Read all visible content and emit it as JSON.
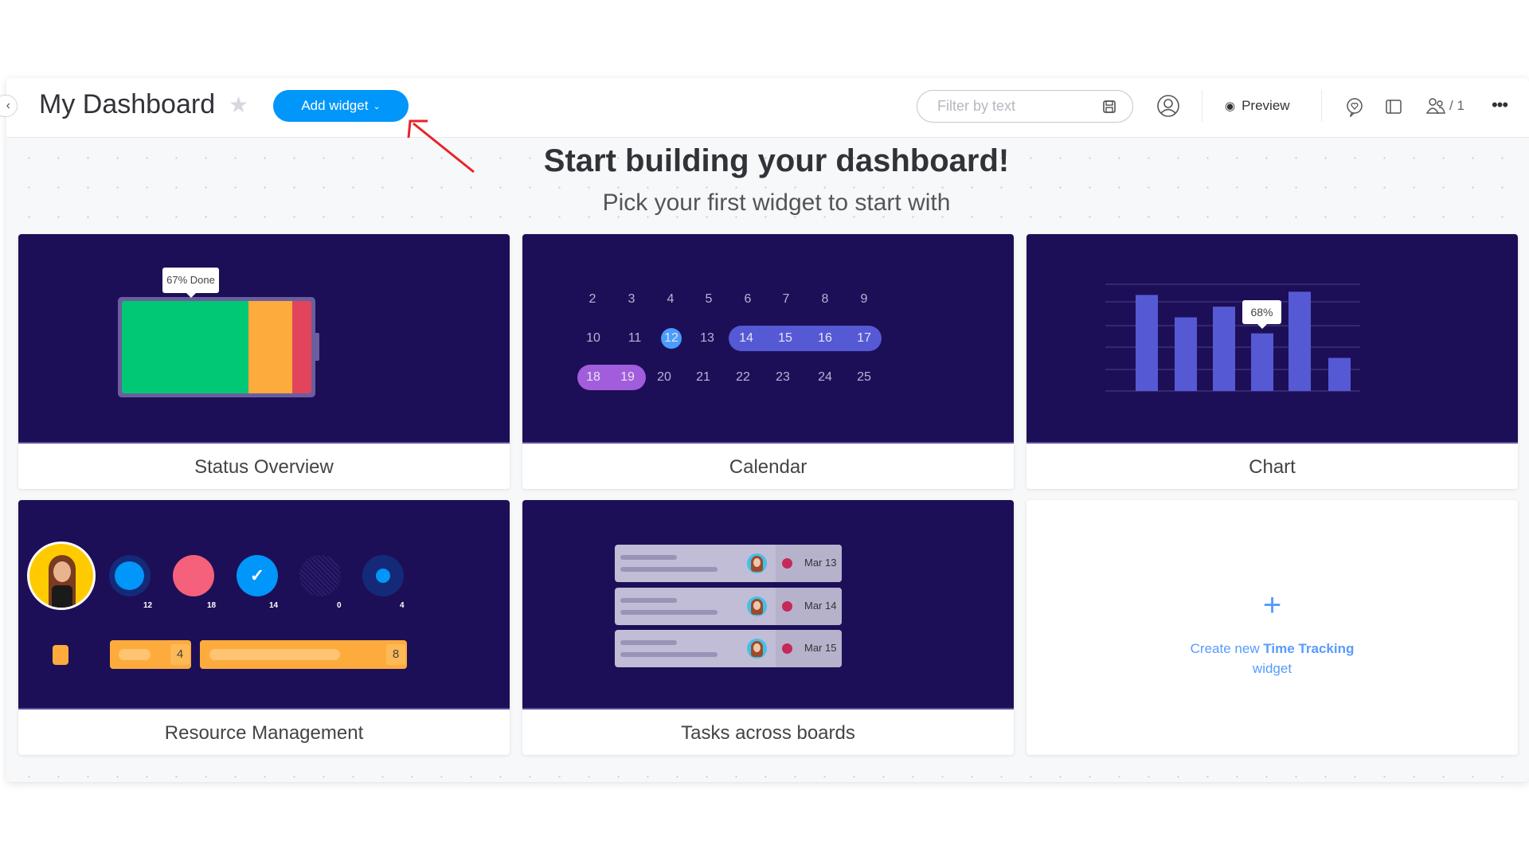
{
  "header": {
    "title": "My Dashboard",
    "add_widget_label": "Add widget",
    "filter_placeholder": "Filter by text",
    "preview_label": "Preview",
    "members_count": "/ 1"
  },
  "intro": {
    "heading": "Start building your dashboard!",
    "subheading": "Pick your first widget to start with"
  },
  "widgets": [
    {
      "label": "Status Overview",
      "tooltip": "67% Done",
      "done_percent": 67,
      "colors": {
        "done": "#00c875",
        "working": "#fdab3d",
        "stuck": "#e2445c"
      }
    },
    {
      "label": "Calendar",
      "rows": [
        [
          "2",
          "3",
          "4",
          "5",
          "6",
          "7",
          "8",
          "9"
        ],
        [
          "10",
          "11",
          "12",
          "13",
          "14",
          "15",
          "16",
          "17"
        ],
        [
          "18",
          "19",
          "20",
          "21",
          "22",
          "23",
          "24",
          "25"
        ]
      ],
      "today": "12"
    },
    {
      "label": "Chart",
      "tooltip": "68%"
    },
    {
      "label": "Resource Management",
      "counts": [
        "12",
        "18",
        "14",
        "0",
        "4"
      ],
      "bar_values": [
        "4",
        "8"
      ]
    },
    {
      "label": "Tasks across boards",
      "dates": [
        "Mar 13",
        "Mar 14",
        "Mar 15"
      ]
    }
  ],
  "create_widget": {
    "prefix": "Create new",
    "name": "Time Tracking",
    "suffix": "widget"
  },
  "chart_data": {
    "type": "bar",
    "values": [
      90,
      69,
      79,
      54,
      93,
      31
    ],
    "ylim": [
      0,
      100
    ],
    "grid": true,
    "color": "#5559d4"
  },
  "colors": {
    "accent": "#0096fa",
    "widget_bg": "#1d0f57",
    "annotation_arrow": "#e8232a"
  }
}
